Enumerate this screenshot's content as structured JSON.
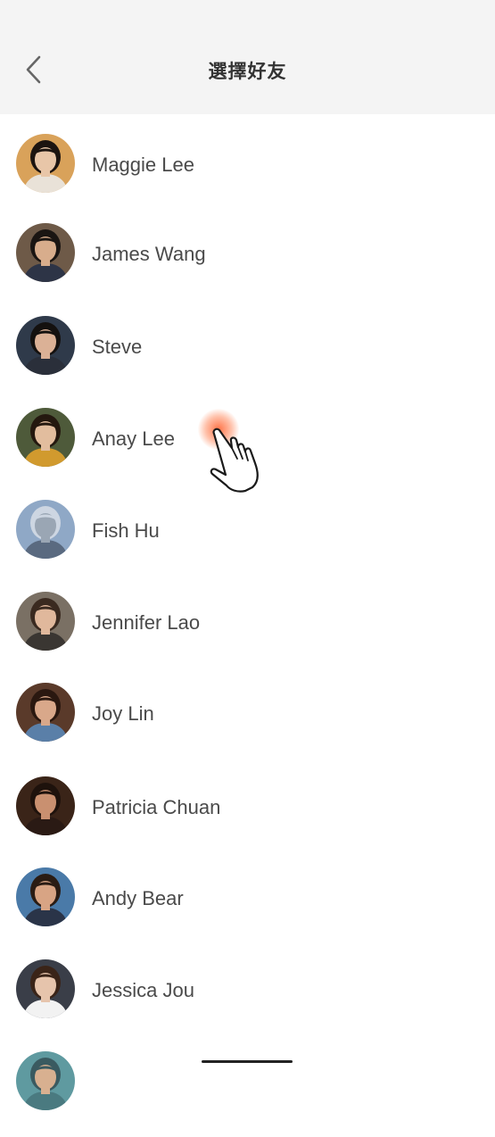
{
  "header": {
    "title": "選擇好友",
    "back_icon": "chevron-left-icon"
  },
  "friends": [
    {
      "name": "Maggie Lee",
      "bg": "#d9a25a",
      "skin": "#e8c6a8",
      "hair": "#1c1410",
      "shirt": "#e9e2d8"
    },
    {
      "name": "James Wang",
      "bg": "#6e5a48",
      "skin": "#d8ad8c",
      "hair": "#1a1512",
      "shirt": "#2d3446"
    },
    {
      "name": "Steve",
      "bg": "#2f3a4a",
      "skin": "#dbb196",
      "hair": "#14110f",
      "shirt": "#2a2f3a"
    },
    {
      "name": "Anay Lee",
      "bg": "#4e5a3a",
      "skin": "#e2bd9e",
      "hair": "#24180f",
      "shirt": "#d19a2e"
    },
    {
      "name": "Fish Hu",
      "bg": "#8fa8c6",
      "skin": "#9aa6b4",
      "hair": "#cdd6e2",
      "shirt": "#5a6a80"
    },
    {
      "name": "Jennifer Lao",
      "bg": "#7a7064",
      "skin": "#e0b89c",
      "hair": "#3a2a20",
      "shirt": "#3a3632"
    },
    {
      "name": "Joy Lin",
      "bg": "#5a3a2a",
      "skin": "#d9a88a",
      "hair": "#2a1810",
      "shirt": "#5a7fa8"
    },
    {
      "name": "Patricia Chuan",
      "bg": "#3a2418",
      "skin": "#c99070",
      "hair": "#1e120c",
      "shirt": "#2a1a14"
    },
    {
      "name": "Andy Bear",
      "bg": "#4a7aa8",
      "skin": "#d8a484",
      "hair": "#2a1c14",
      "shirt": "#2a3448"
    },
    {
      "name": "Jessica Jou",
      "bg": "#3a3e48",
      "skin": "#e6c4ac",
      "hair": "#3a2418",
      "shirt": "#f2f2f2"
    },
    {
      "name": "",
      "bg": "#5f9aa0",
      "skin": "#d8b090",
      "hair": "#3a5a60",
      "shirt": "#4a7a80"
    }
  ],
  "colors": {
    "header_bg": "#f4f4f4",
    "name_text": "#4a4a4a",
    "tap_highlight": "#ff5c28"
  },
  "overlay": {
    "pointer_icon": "hand-pointer-icon",
    "tap_icon": "tap-highlight-icon"
  }
}
